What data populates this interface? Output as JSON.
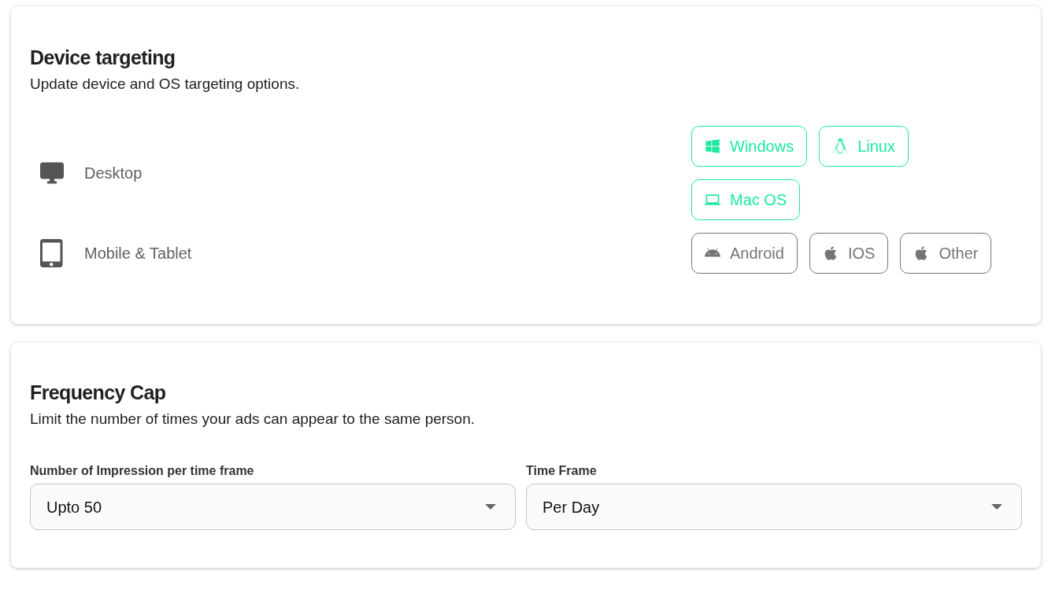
{
  "device_targeting": {
    "title": "Device targeting",
    "description": "Update device and OS targeting options.",
    "devices": [
      {
        "kind": "desktop",
        "label": "Desktop",
        "options": [
          {
            "kind": "windows",
            "label": "Windows",
            "selected": true
          },
          {
            "kind": "linux",
            "label": "Linux",
            "selected": true
          },
          {
            "kind": "laptop",
            "label": "Mac OS",
            "selected": true
          }
        ]
      },
      {
        "kind": "tablet",
        "label": "Mobile & Tablet",
        "options": [
          {
            "kind": "android",
            "label": "Android",
            "selected": false
          },
          {
            "kind": "apple",
            "label": "IOS",
            "selected": false
          },
          {
            "kind": "apple",
            "label": "Other",
            "selected": false
          }
        ]
      }
    ]
  },
  "frequency_cap": {
    "title": "Frequency Cap",
    "description": "Limit the number of times your ads can appear to the same person.",
    "fields": [
      {
        "label": "Number of Impression per time frame",
        "value": "Upto 50"
      },
      {
        "label": "Time Frame",
        "value": "Per Day"
      }
    ]
  }
}
